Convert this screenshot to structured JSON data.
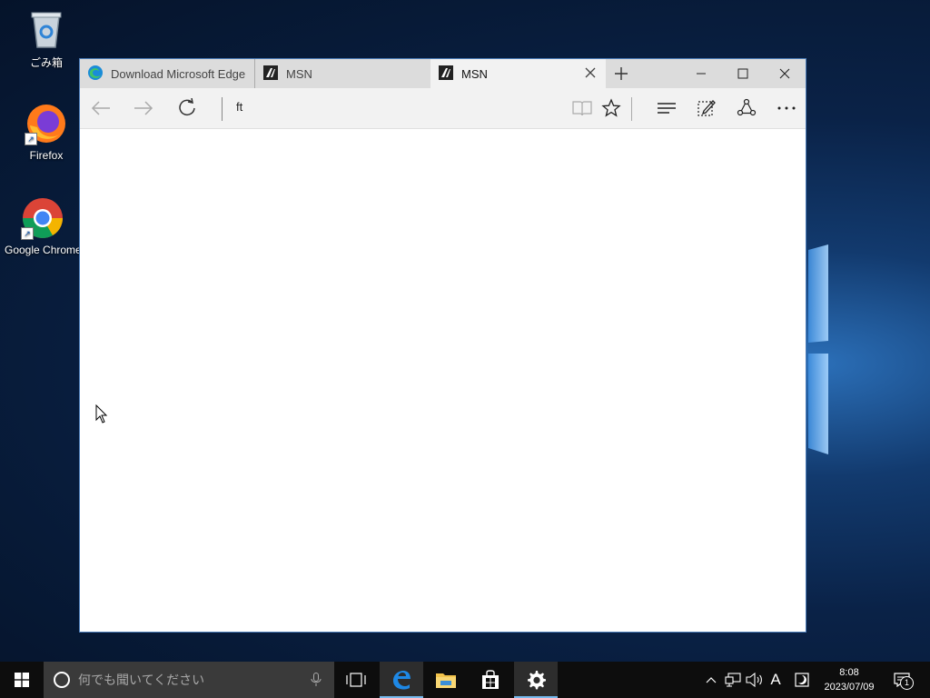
{
  "desktop": {
    "icons": [
      {
        "label": "ごみ箱",
        "icon": "recycle-bin-icon"
      },
      {
        "label": "Firefox",
        "icon": "firefox-icon"
      },
      {
        "label": "Google Chrome",
        "icon": "chrome-icon"
      }
    ]
  },
  "browser": {
    "tabs": [
      {
        "label": "Download Microsoft Edge",
        "icon": "edge-logo-icon",
        "active": false
      },
      {
        "label": "MSN",
        "icon": "msn-icon",
        "active": false
      },
      {
        "label": "MSN",
        "icon": "msn-icon",
        "active": true
      }
    ],
    "address_text": "ft",
    "colors": {
      "tabbar": "#dcdcdc",
      "toolbar": "#f2f2f2",
      "border": "#4a7bb7"
    }
  },
  "taskbar": {
    "search_placeholder": "何でも聞いてください",
    "clock": {
      "time": "8:08",
      "date": "2023/07/09"
    },
    "ime_indicator": "A",
    "notification_count": "1",
    "apps": [
      "task-view-icon",
      "edge-icon",
      "file-explorer-icon",
      "store-icon",
      "settings-icon"
    ]
  }
}
